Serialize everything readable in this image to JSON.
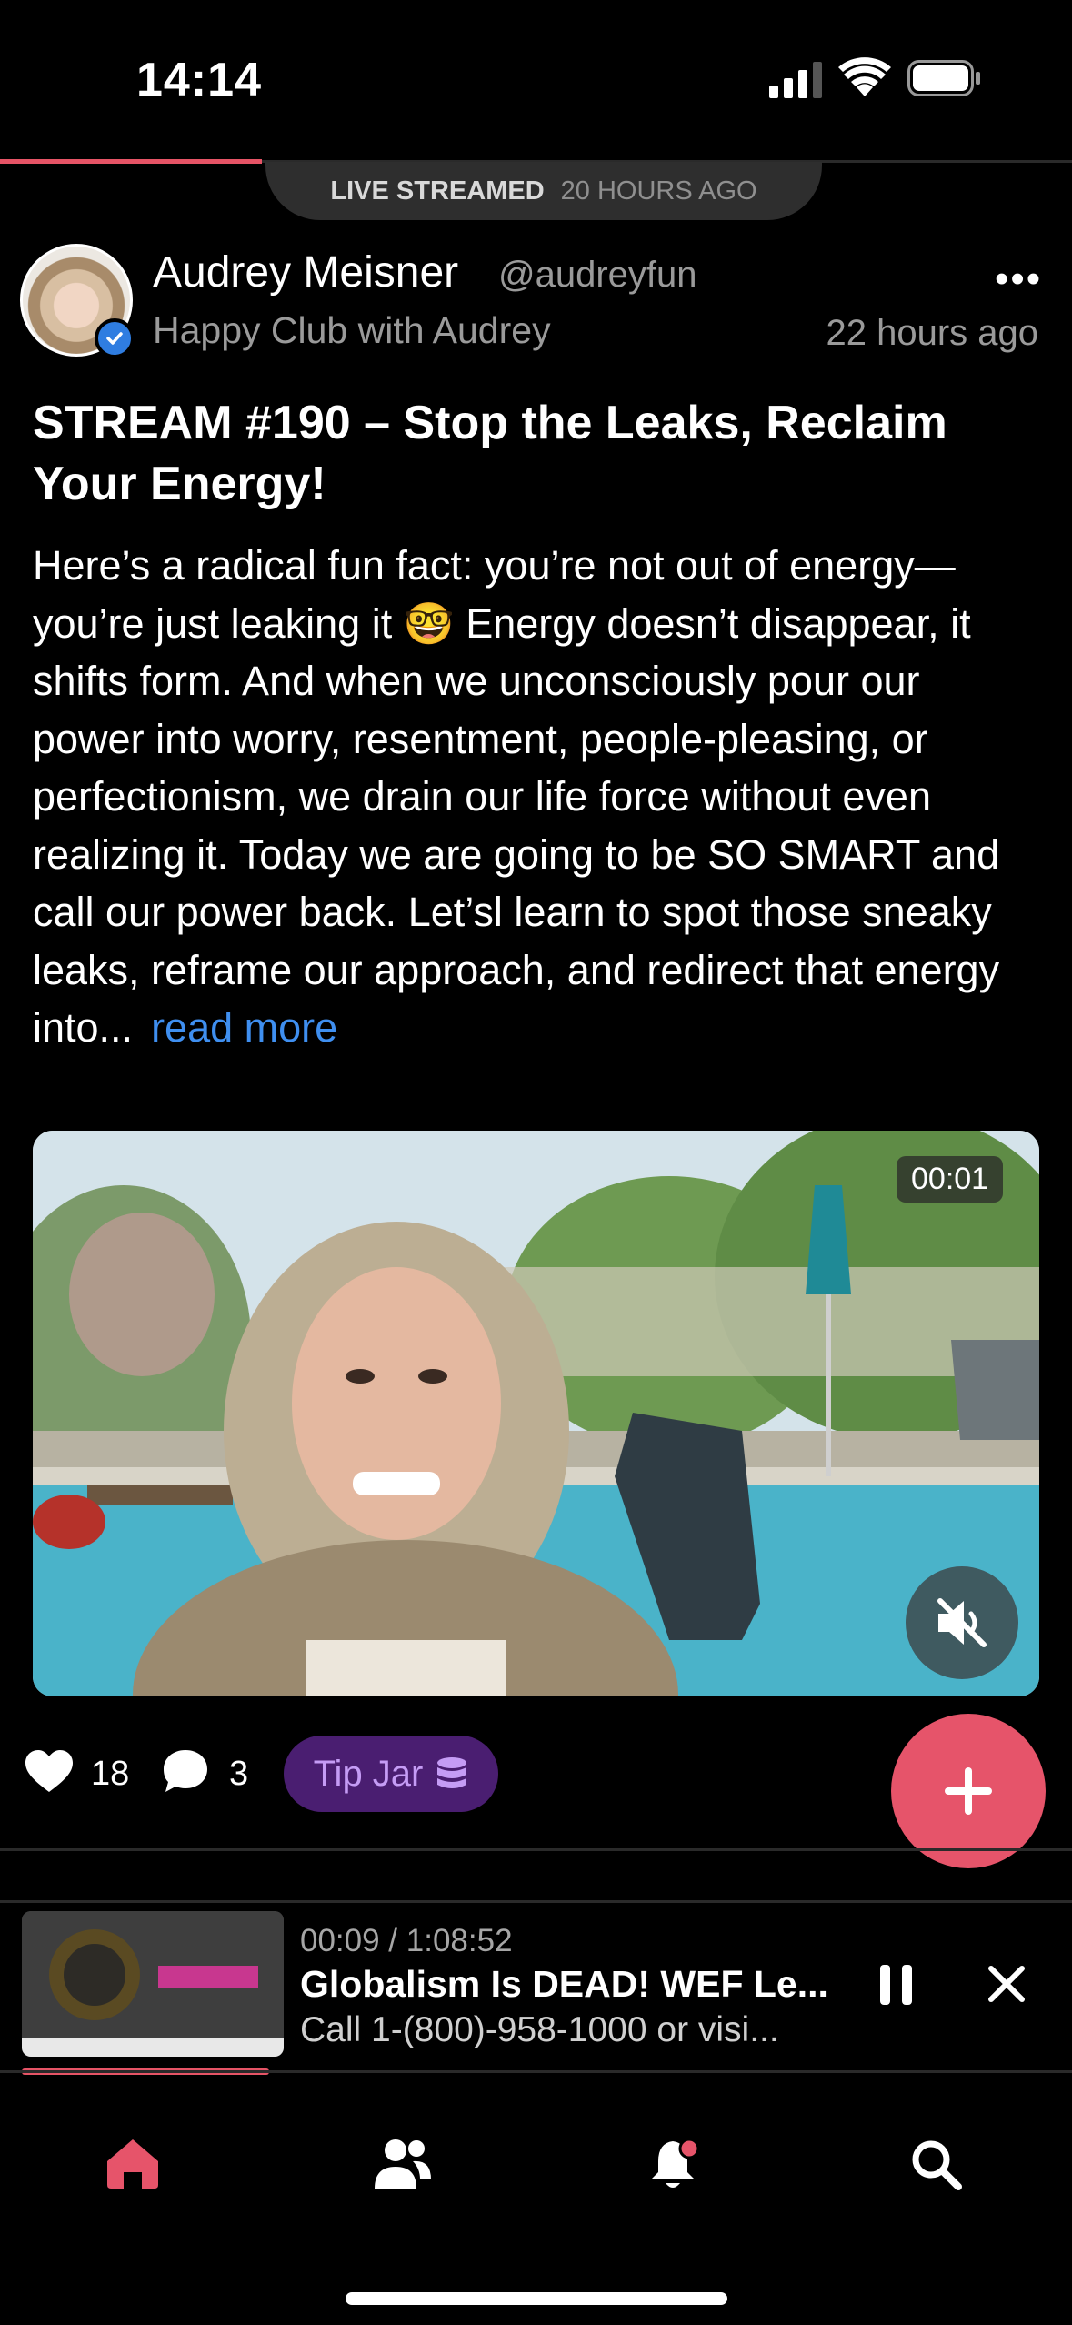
{
  "status_bar": {
    "time": "14:14"
  },
  "live_banner": {
    "label": "LIVE STREAMED",
    "when": "20 HOURS AGO"
  },
  "author": {
    "name": "Audrey Meisner",
    "handle": "@audreyfun",
    "club": "Happy Club with Audrey",
    "posted": "22 hours ago",
    "verified": true
  },
  "post": {
    "title": "STREAM #190 – Stop the Leaks, Reclaim Your Energy!",
    "body": "Here’s a radical fun fact: you’re not out of energy—you’re just leaking it 🤓 Energy doesn’t disappear, it shifts form. And when we unconsciously pour our power into worry, resentment, people-pleasing, or perfectionism, we drain our life force without even realizing it. Today we are going to be SO SMART and call our power back. Let’sl learn to spot those sneaky leaks, reframe our approach, and redirect that energy into...",
    "read_more": "read more"
  },
  "video": {
    "timer": "00:01",
    "muted": true
  },
  "actions": {
    "likes": "18",
    "comments": "3",
    "tip_jar": "Tip Jar"
  },
  "mini_player": {
    "time": "00:09 / 1:08:52",
    "title": "Globalism Is DEAD! WEF Le...",
    "subtitle": "Call 1-(800)-958-1000 or visi...",
    "progress": 0.14
  },
  "tabs": [
    {
      "name": "home",
      "icon": "home-icon",
      "active": true
    },
    {
      "name": "community",
      "icon": "people-icon",
      "active": false
    },
    {
      "name": "notifications",
      "icon": "bell-icon",
      "active": false,
      "badge": true
    },
    {
      "name": "search",
      "icon": "search-icon",
      "active": false
    }
  ],
  "colors": {
    "accent": "#e6546a",
    "link": "#3f8ff0",
    "tip_bg": "#4a1e71",
    "tip_text": "#c59cf5"
  }
}
